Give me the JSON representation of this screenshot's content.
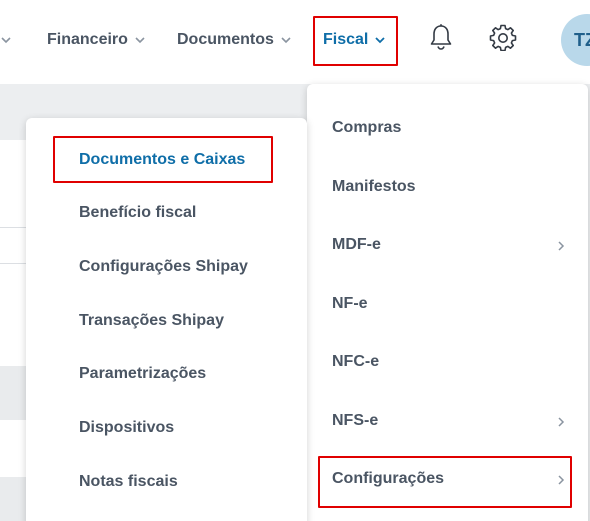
{
  "navbar": {
    "items": [
      {
        "label": "Financeiro"
      },
      {
        "label": "Documentos"
      },
      {
        "label": "Fiscal"
      }
    ],
    "bell_icon": "bell-icon",
    "settings_icon": "gear-icon",
    "avatar_initials": "TZ"
  },
  "fiscal_menu": {
    "items": [
      {
        "label": "Compras"
      },
      {
        "label": "Manifestos"
      },
      {
        "label": "MDF-e"
      },
      {
        "label": "NF-e"
      },
      {
        "label": "NFC-e"
      },
      {
        "label": "NFS-e"
      },
      {
        "label": "Configurações"
      }
    ]
  },
  "config_submenu": {
    "items": [
      {
        "label": "Documentos e Caixas"
      },
      {
        "label": "Benefício fiscal"
      },
      {
        "label": "Configurações Shipay"
      },
      {
        "label": "Transações Shipay"
      },
      {
        "label": "Parametrizações"
      },
      {
        "label": "Dispositivos"
      },
      {
        "label": "Notas fiscais"
      }
    ]
  },
  "colors": {
    "accent": "#0f6ea8",
    "text": "#4a5563",
    "highlight_box": "#e00000"
  }
}
